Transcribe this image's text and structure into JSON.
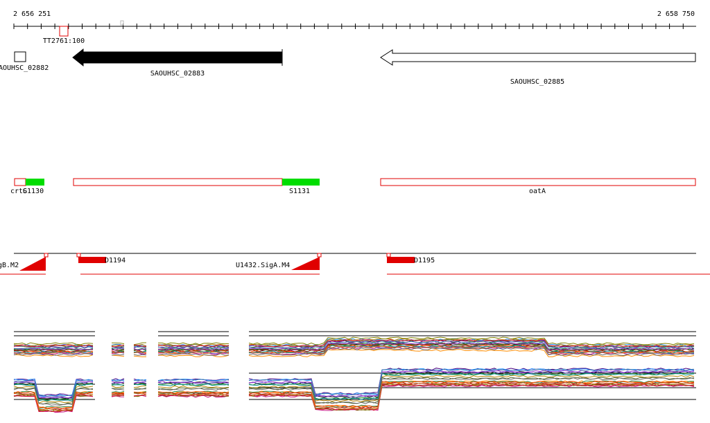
{
  "coordinates": {
    "start": "2 656 251",
    "end": "2 658 750"
  },
  "colors": {
    "axis": "#000000",
    "red": "#e00000",
    "green": "#00dd00",
    "black": "#000000"
  },
  "labels": {
    "terminator": "TT2761:100",
    "gene_left": "AOUHSC_02882",
    "gene_mid": "SAOUHSC_02883",
    "gene_right": "SAOUHSC_02885",
    "tu_left_a": "crtG",
    "tu_left_b": "S1130",
    "tu_mid": "S1131",
    "tu_right": "oatA",
    "prom_left": "gB.M2",
    "prom_d1194": "D1194",
    "prom_mid": "U1432.SigA.M4",
    "prom_d1195": "D1195"
  },
  "expression": {
    "line_colors": [
      "#000000",
      "#8b0000",
      "#228b22",
      "#ff8c00",
      "#4b0082",
      "#1e90ff",
      "#b8860b",
      "#c71585",
      "#2e8b57",
      "#8b4513",
      "#6a5acd",
      "#808000",
      "#ff4500",
      "#008b8b",
      "#9932cc",
      "#556b2f",
      "#dc143c",
      "#4682b4",
      "#d2691e",
      "#696969"
    ]
  }
}
